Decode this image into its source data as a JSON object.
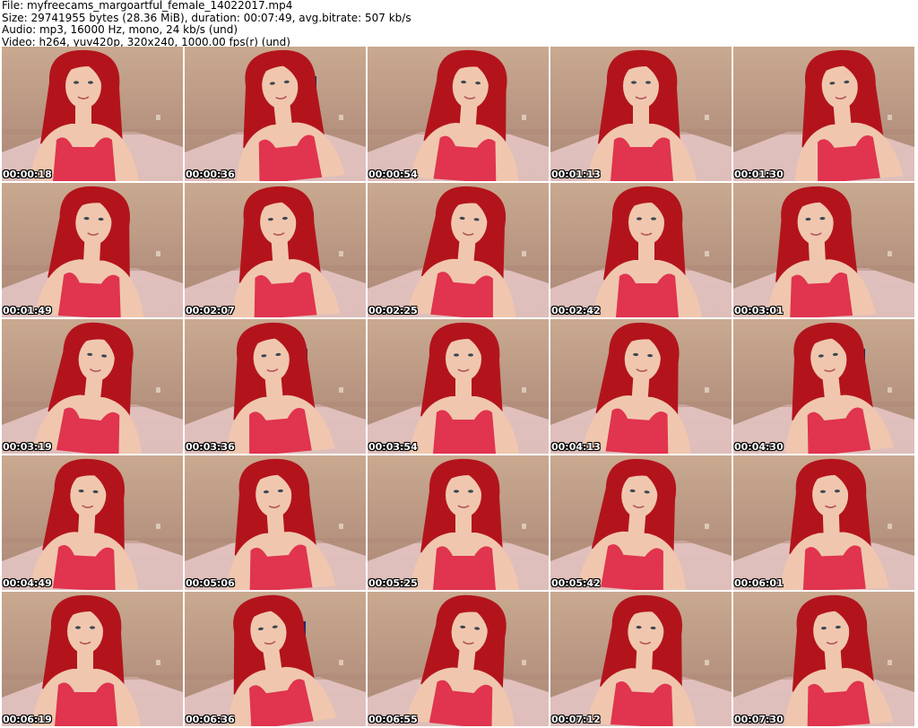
{
  "header": {
    "file_line": "File: myfreecams_margoartful_female_14022017.mp4",
    "size_line": "Size: 29741955 bytes (28.36 MiB), duration: 00:07:49, avg.bitrate: 507 kb/s",
    "audio_line": "Audio: mp3, 16000 Hz, mono, 24 kb/s (und)",
    "video_line": "Video: h264, yuv420p, 320x240, 1000.00 fps(r) (und)"
  },
  "thumbnails": [
    {
      "timestamp": "00:00:18"
    },
    {
      "timestamp": "00:00:36"
    },
    {
      "timestamp": "00:00:54"
    },
    {
      "timestamp": "00:01:13"
    },
    {
      "timestamp": "00:01:30"
    },
    {
      "timestamp": "00:01:49"
    },
    {
      "timestamp": "00:02:07"
    },
    {
      "timestamp": "00:02:25"
    },
    {
      "timestamp": "00:02:42"
    },
    {
      "timestamp": "00:03:01"
    },
    {
      "timestamp": "00:03:19"
    },
    {
      "timestamp": "00:03:36"
    },
    {
      "timestamp": "00:03:54"
    },
    {
      "timestamp": "00:04:13"
    },
    {
      "timestamp": "00:04:30"
    },
    {
      "timestamp": "00:04:49"
    },
    {
      "timestamp": "00:05:06"
    },
    {
      "timestamp": "00:05:25"
    },
    {
      "timestamp": "00:05:42"
    },
    {
      "timestamp": "00:06:01"
    },
    {
      "timestamp": "00:06:19"
    },
    {
      "timestamp": "00:06:36"
    },
    {
      "timestamp": "00:06:55"
    },
    {
      "timestamp": "00:07:12"
    },
    {
      "timestamp": "00:07:30"
    }
  ],
  "colors": {
    "wall": "#c9a990",
    "floor": "#e8c8c8",
    "hair": "#b3141c",
    "skin": "#f0c7ae",
    "top": "#e0344f"
  }
}
